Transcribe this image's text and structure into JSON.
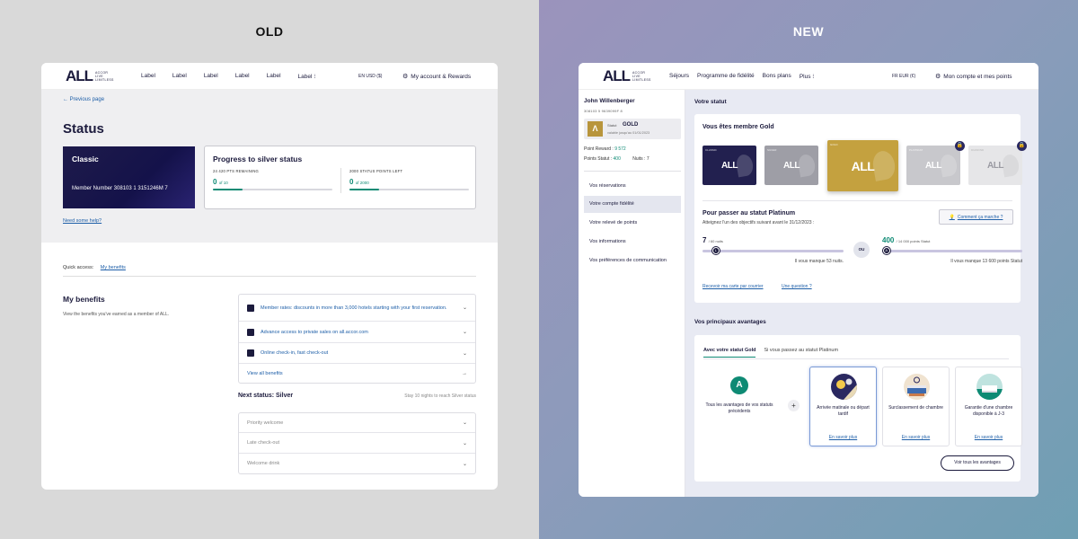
{
  "labels": {
    "old": "OLD",
    "new": "NEW"
  },
  "old": {
    "logo": {
      "all": "ALL",
      "line1": "ACCOR",
      "line2": "LIVE",
      "line3": "LIMITLESS"
    },
    "nav": [
      "Label",
      "Label",
      "Label",
      "Label",
      "Label",
      "Label ⁝"
    ],
    "lang": "EN   USD ($)",
    "account": "My account & Rewards",
    "previous_page": "Previous page",
    "title": "Status",
    "classic_card": {
      "title": "Classic",
      "member": "Member Number 308103 1 3151246M 7"
    },
    "progress": {
      "title": "Progress to silver status",
      "left": {
        "label": "24 420 PTS REMAINING",
        "value": "0",
        "of": "of 10",
        "fill": 0.25
      },
      "right": {
        "label": "2000 STATUS POINTS LEFT",
        "value": "0",
        "of": "of 2000",
        "fill": 0.25
      }
    },
    "help": "Need some help?",
    "quick_access": {
      "label": "Quick access:",
      "link": "My benefits"
    },
    "benefits": {
      "title": "My benefits",
      "desc": "View the benefits you've earned as a member of ALL.",
      "items": [
        "Member rates: discounts in more than 3,000 hotels starting with your first reservation.",
        "Advance access to private sales on all.accor.com",
        "Online check-in, fast check-out"
      ],
      "view_all": "View all benefits"
    },
    "next_status": {
      "title": "Next status: Silver",
      "stay": "Stay 10 nights to reach Silver status",
      "items": [
        "Priority welcome",
        "Late check-out",
        "Welcome drink"
      ]
    }
  },
  "new": {
    "logo": {
      "all": "ALL",
      "line1": "ACCOR",
      "line2": "LIVE",
      "line3": "LIMITLESS"
    },
    "nav": [
      "Séjours",
      "Programme de fidélité",
      "Bons plans",
      "Plus ⁝"
    ],
    "lang": "FR   EUR (€)",
    "account": "Mon compte et mes points",
    "user": {
      "name": "John Willenberger",
      "id": "308103 5 9639099F 8",
      "status_label": "Statut",
      "status_value": "GOLD",
      "valid": "valable jusqu'au 01/01/2023",
      "reward_label": "Point Reward :",
      "reward_value": "9 572",
      "statut_label": "Points Statut :",
      "statut_value": "400",
      "nights": "Nuits : 7"
    },
    "menu": [
      "Vos réservations",
      "Votre compte fidélité",
      "Votre relevé de points",
      "Vos informations",
      "Vos préférences de communication"
    ],
    "status_section": "Votre statut",
    "member_gold": "Vous êtes membre Gold",
    "tiers": [
      {
        "label": "CLASSIC",
        "color": "#22204f"
      },
      {
        "label": "SILVER",
        "color": "#9e9ea6"
      },
      {
        "label": "GOLD",
        "color": "#c4a13f"
      },
      {
        "label": "PLATINUM",
        "color": "#c8c8cc"
      },
      {
        "label": "DIAMOND",
        "color": "#e6e6e8"
      }
    ],
    "platinum": {
      "title": "Pour passer au statut Platinum",
      "subtitle": "Atteignez l'un des objectifs suivant avant le 31/12/2023 :",
      "how": "Comment ça marche ?",
      "nights_value": "7",
      "nights_of": "/ 60 nuits",
      "nights_fill": 0.12,
      "points_value": "400",
      "points_of": "/ 14 000 points Statut",
      "points_fill": 0.03,
      "or": "OU",
      "nights_remain": "Il vous manque 53 nuits.",
      "points_remain": "Il vous manque 13 600 points Statut",
      "knob_left": "L",
      "knob_right": "A",
      "link1": "Recevoir ma carte par courrier",
      "link2": "Une question ?"
    },
    "advantages": {
      "title": "Vos principaux avantages",
      "tab1": "Avec votre statut Gold",
      "tab2": "Si vous passez au statut Platinum",
      "previous": "Tous les avantages de vos statuts précédents",
      "plus": "+",
      "accor_letter": "A",
      "cards": [
        {
          "text": "Arrivée matinale ou départ tardif",
          "link": "En savoir plus"
        },
        {
          "text": "Surclassement de chambre",
          "link": "En savoir plus"
        },
        {
          "text": "Garantie d'une chambre disponible à J-3",
          "link": "En savoir plus"
        }
      ],
      "see_all": "Voir tous les avantages"
    }
  }
}
